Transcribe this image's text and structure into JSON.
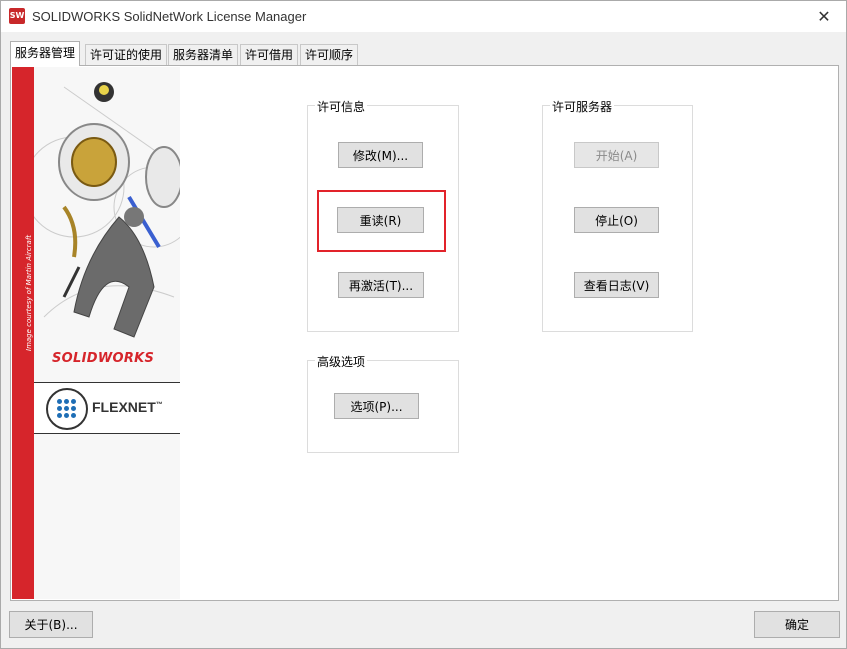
{
  "window": {
    "title": "SOLIDWORKS SolidNetWork License Manager",
    "close_glyph": "✕"
  },
  "tabs": [
    {
      "label": "服务器管理",
      "active": true
    },
    {
      "label": "许可证的使用",
      "active": false
    },
    {
      "label": "服务器清单",
      "active": false
    },
    {
      "label": "许可借用",
      "active": false
    },
    {
      "label": "许可顺序",
      "active": false
    }
  ],
  "sidebar": {
    "image_credit": "Image courtesy of Martin Aircraft",
    "solidworks_logo": "SOLIDWORKS",
    "flexnet_logo": "FLEXNET"
  },
  "license_info": {
    "title": "许可信息",
    "modify_label": "修改(M)...",
    "reread_label": "重读(R)",
    "reactivate_label": "再激活(T)..."
  },
  "license_server": {
    "title": "许可服务器",
    "start_label": "开始(A)",
    "stop_label": "停止(O)",
    "view_log_label": "查看日志(V)"
  },
  "advanced": {
    "title": "高级选项",
    "options_label": "选项(P)..."
  },
  "footer": {
    "about_label": "关于(B)...",
    "ok_label": "确定"
  },
  "colors": {
    "accent_red": "#d6252b",
    "highlight_red": "#e2232a",
    "flexnet_blue": "#1e6eb5"
  }
}
